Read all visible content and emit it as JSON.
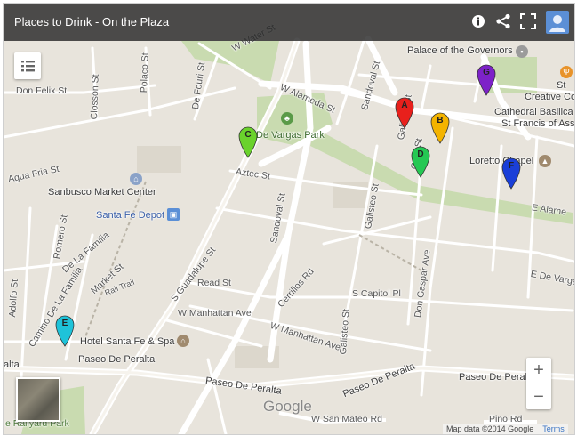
{
  "header": {
    "title": "Places to Drink - On the Plaza",
    "icons": [
      "info-icon",
      "share-icon",
      "fullscreen-icon",
      "account-avatar"
    ]
  },
  "map": {
    "streets": {
      "water_st": "W Water St",
      "alameda_w": "W Alameda St",
      "alameda_e": "E Alame",
      "don_felix": "Don Felix St",
      "closson": "Closson St",
      "polaco": "Polaco St",
      "de_fouri": "De Fouri St",
      "sandoval_n": "Sandoval St",
      "sandoval_s": "Sandoval St",
      "aztec": "Aztec St",
      "agua_fria": "Agua Fria St",
      "galisteo_n": "Galisteo St",
      "galisteo_s": "Galisteo St",
      "galisteo_top": "Galisteo St",
      "ortiz": "Ortiz St",
      "romero": "Romero St",
      "de_la_familia": "De La Familia",
      "market": "Market St",
      "rail_trail": "Rail Trail",
      "camino_familia": "Camino De La Familia",
      "adolfo": "Adolfo St",
      "guadalupe": "S Guadalupe St",
      "cerrillos": "Cerrillos Rd",
      "read": "Read St",
      "capitol": "S Capitol Pl",
      "don_gaspar": "Don Gaspar Ave",
      "de_vargas_st": "E De Varga",
      "manhattan_w1": "W Manhattan Ave",
      "manhattan_w2": "W Manhattan Ave",
      "peralta_1": "Paseo De Peralta",
      "peralta_2": "Paseo De Peralta",
      "peralta_3": "Paseo De Peralta",
      "peralta_4": "Paseo De Peralta",
      "peralta_left": "alta",
      "san_mateo": "W San Mateo Rd",
      "pino": "Pino Rd",
      "park_name": "e Railyard Park"
    },
    "places": {
      "palace": "Palace of the Governors",
      "creative1": "St",
      "creative2": "Creative Cook",
      "cathedral1": "Cathedral Basilica",
      "cathedral2": "St Francis of Assi",
      "loretto": "Loretto Chapel",
      "sanbusco": "Sanbusco Market Center",
      "depot": "Santa Fe Depot",
      "hotel": "Hotel Santa Fe & Spa",
      "park": "De Vargas Park"
    },
    "markers": [
      {
        "letter": "A",
        "color": "#e8201c"
      },
      {
        "letter": "B",
        "color": "#f4b400"
      },
      {
        "letter": "C",
        "color": "#6ad22c"
      },
      {
        "letter": "D",
        "color": "#25c853"
      },
      {
        "letter": "E",
        "color": "#1ec3d9"
      },
      {
        "letter": "F",
        "color": "#1a3fd8"
      },
      {
        "letter": "G",
        "color": "#7d22c8"
      }
    ],
    "controls": {
      "zoom_in": "+",
      "zoom_out": "−",
      "google_logo": "Google",
      "attribution": "Map data ©2014 Google",
      "terms": "Terms"
    }
  }
}
